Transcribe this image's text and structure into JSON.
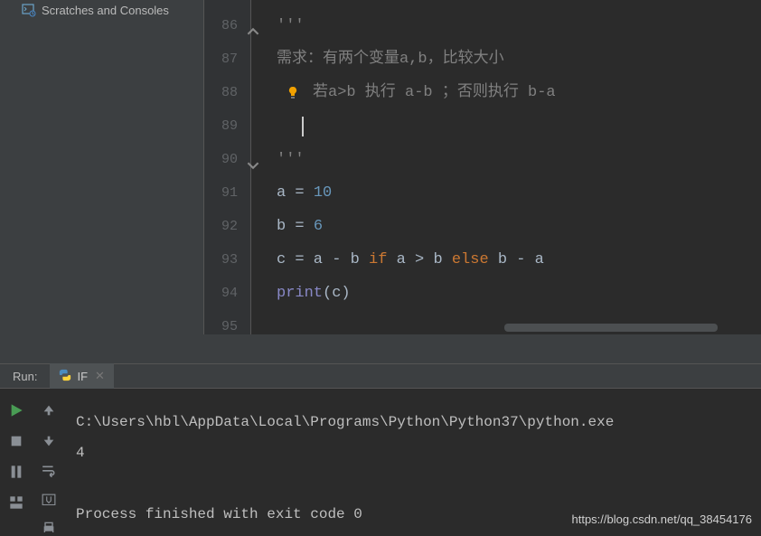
{
  "sidebar": {
    "items": [
      {
        "label": "Scratches and Consoles"
      }
    ]
  },
  "editor": {
    "gutter_start": 86,
    "lines": [
      {
        "n": 86,
        "type": "cmt",
        "text": "'''",
        "fold": "up"
      },
      {
        "n": 87,
        "type": "cmt",
        "text": "需求：有两个变量a,b，比较大小"
      },
      {
        "n": 88,
        "type": "cmt",
        "text": "若a>b 执行 a-b ；否则执行 b-a",
        "bulb": true
      },
      {
        "n": 89,
        "type": "caret"
      },
      {
        "n": 90,
        "type": "cmt",
        "text": "'''",
        "fold": "down"
      },
      {
        "n": 91,
        "type": "code",
        "tokens": [
          [
            "a = ",
            "plain"
          ],
          [
            "10",
            "num"
          ]
        ]
      },
      {
        "n": 92,
        "type": "code",
        "tokens": [
          [
            "b = ",
            "plain"
          ],
          [
            "6",
            "num"
          ]
        ]
      },
      {
        "n": 93,
        "type": "code",
        "tokens": [
          [
            "c = a - b ",
            "plain"
          ],
          [
            "if",
            "kw"
          ],
          [
            " a > b ",
            "plain"
          ],
          [
            "else",
            "kw"
          ],
          [
            " b - a",
            "plain"
          ]
        ]
      },
      {
        "n": 94,
        "type": "code",
        "tokens": [
          [
            "print",
            "fn"
          ],
          [
            "(c)",
            "plain"
          ]
        ]
      },
      {
        "n": 95,
        "type": "blank"
      }
    ]
  },
  "run": {
    "panel_label": "Run:",
    "tab_label": "IF",
    "output_path": "C:\\Users\\hbl\\AppData\\Local\\Programs\\Python\\Python37\\python.exe",
    "output_value": "4",
    "exit_msg": "Process finished with exit code 0"
  },
  "watermark": "https://blog.csdn.net/qq_38454176"
}
